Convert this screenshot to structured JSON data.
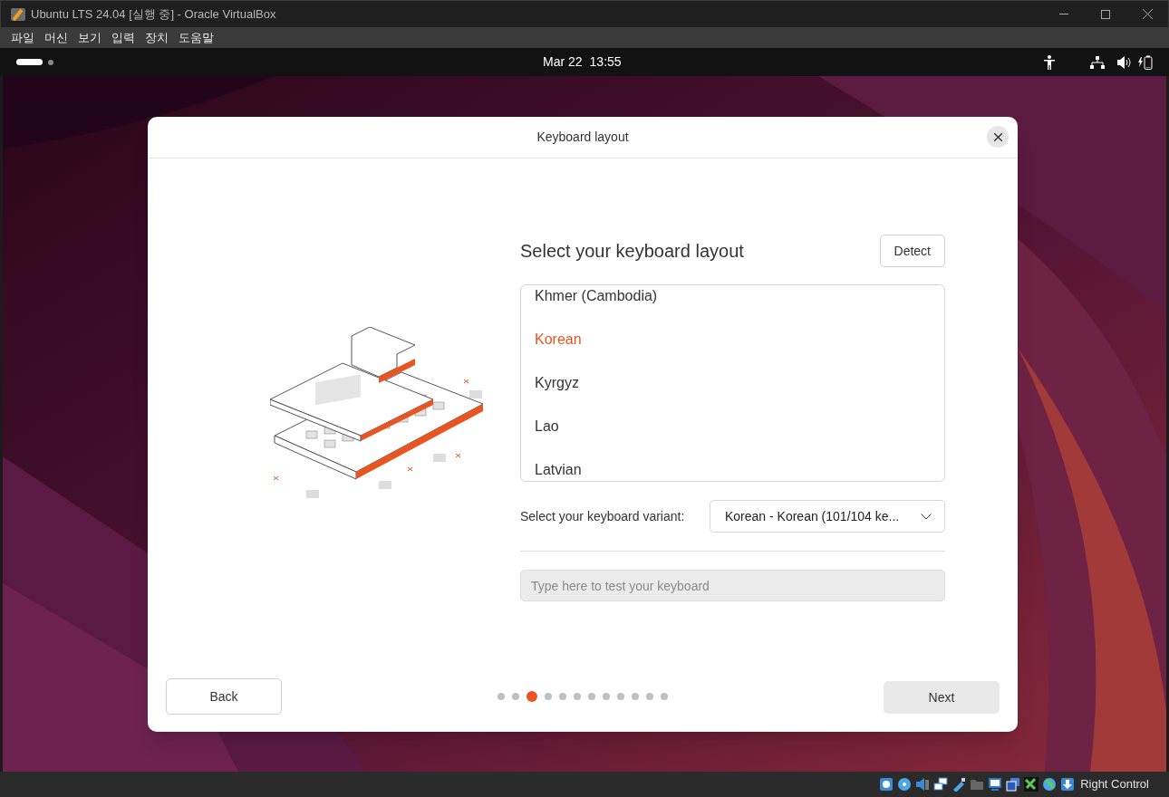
{
  "window": {
    "title": "Ubuntu LTS 24.04 [실행 중] - Oracle VirtualBox"
  },
  "menu": [
    "파일",
    "머신",
    "보기",
    "입력",
    "장치",
    "도움말"
  ],
  "top_bar": {
    "date": "Mar 22",
    "time": "13:55"
  },
  "dialog": {
    "title": "Keyboard layout",
    "heading": "Select your keyboard layout",
    "detect_button": "Detect",
    "layouts": [
      {
        "label": "Khmer (Cambodia)",
        "selected": false
      },
      {
        "label": "Korean",
        "selected": true
      },
      {
        "label": "Kyrgyz",
        "selected": false
      },
      {
        "label": "Lao",
        "selected": false
      },
      {
        "label": "Latvian",
        "selected": false
      }
    ],
    "variant_label": "Select your keyboard variant:",
    "variant_value": "Korean - Korean (101/104 ke...",
    "test_field": {
      "placeholder": "Type here to test your keyboard"
    },
    "back_button": "Back",
    "next_button": "Next",
    "steps": [
      {
        "selected": false
      },
      {
        "selected": false
      },
      {
        "selected": true
      },
      {
        "selected": false
      },
      {
        "selected": false
      },
      {
        "selected": false
      },
      {
        "selected": false
      },
      {
        "selected": false
      },
      {
        "selected": false
      },
      {
        "selected": false
      },
      {
        "selected": false
      },
      {
        "selected": false
      }
    ]
  },
  "status_bar": {
    "host_key": "Right Control"
  }
}
